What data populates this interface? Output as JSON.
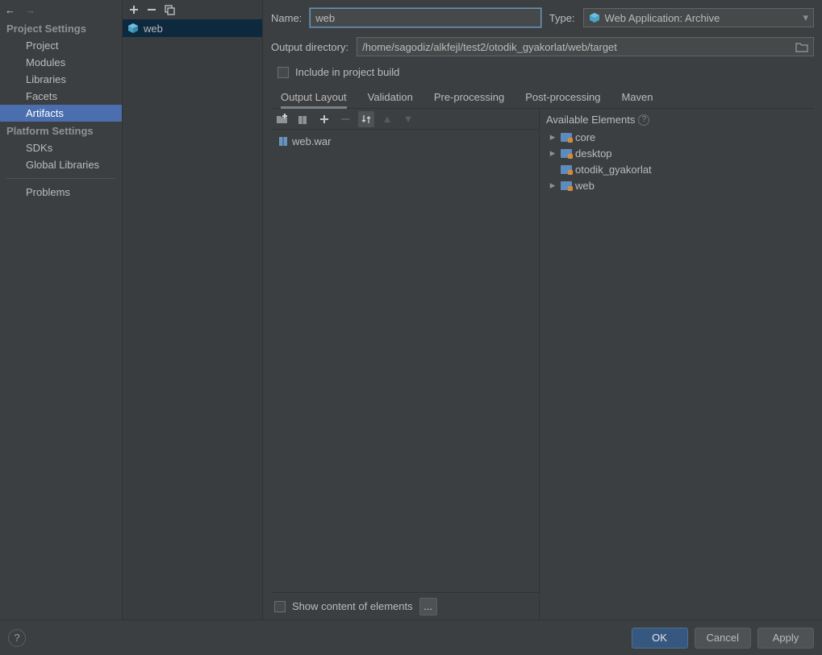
{
  "sidebar": {
    "headers": {
      "project": "Project Settings",
      "platform": "Platform Settings"
    },
    "project_items": [
      "Project",
      "Modules",
      "Libraries",
      "Facets",
      "Artifacts"
    ],
    "platform_items": [
      "SDKs",
      "Global Libraries"
    ],
    "extra_items": [
      "Problems"
    ],
    "selected": "Artifacts"
  },
  "artifact_list": {
    "items": [
      {
        "name": "web"
      }
    ]
  },
  "form": {
    "name_label": "Name:",
    "name_value": "web",
    "type_label": "Type:",
    "type_value": "Web Application: Archive",
    "output_dir_label": "Output directory:",
    "output_dir_value": "/home/sagodiz/alkfejl/test2/otodik_gyakorlat/web/target",
    "include_build_label": "Include in project build"
  },
  "tabs": [
    "Output Layout",
    "Validation",
    "Pre-processing",
    "Post-processing",
    "Maven"
  ],
  "active_tab": "Output Layout",
  "output_tree": {
    "root": "web.war"
  },
  "available": {
    "header": "Available Elements",
    "items": [
      {
        "name": "core",
        "expandable": true
      },
      {
        "name": "desktop",
        "expandable": true
      },
      {
        "name": "otodik_gyakorlat",
        "expandable": false
      },
      {
        "name": "web",
        "expandable": true
      }
    ]
  },
  "bottom": {
    "show_content_label": "Show content of elements",
    "more": "..."
  },
  "footer": {
    "ok": "OK",
    "cancel": "Cancel",
    "apply": "Apply"
  }
}
